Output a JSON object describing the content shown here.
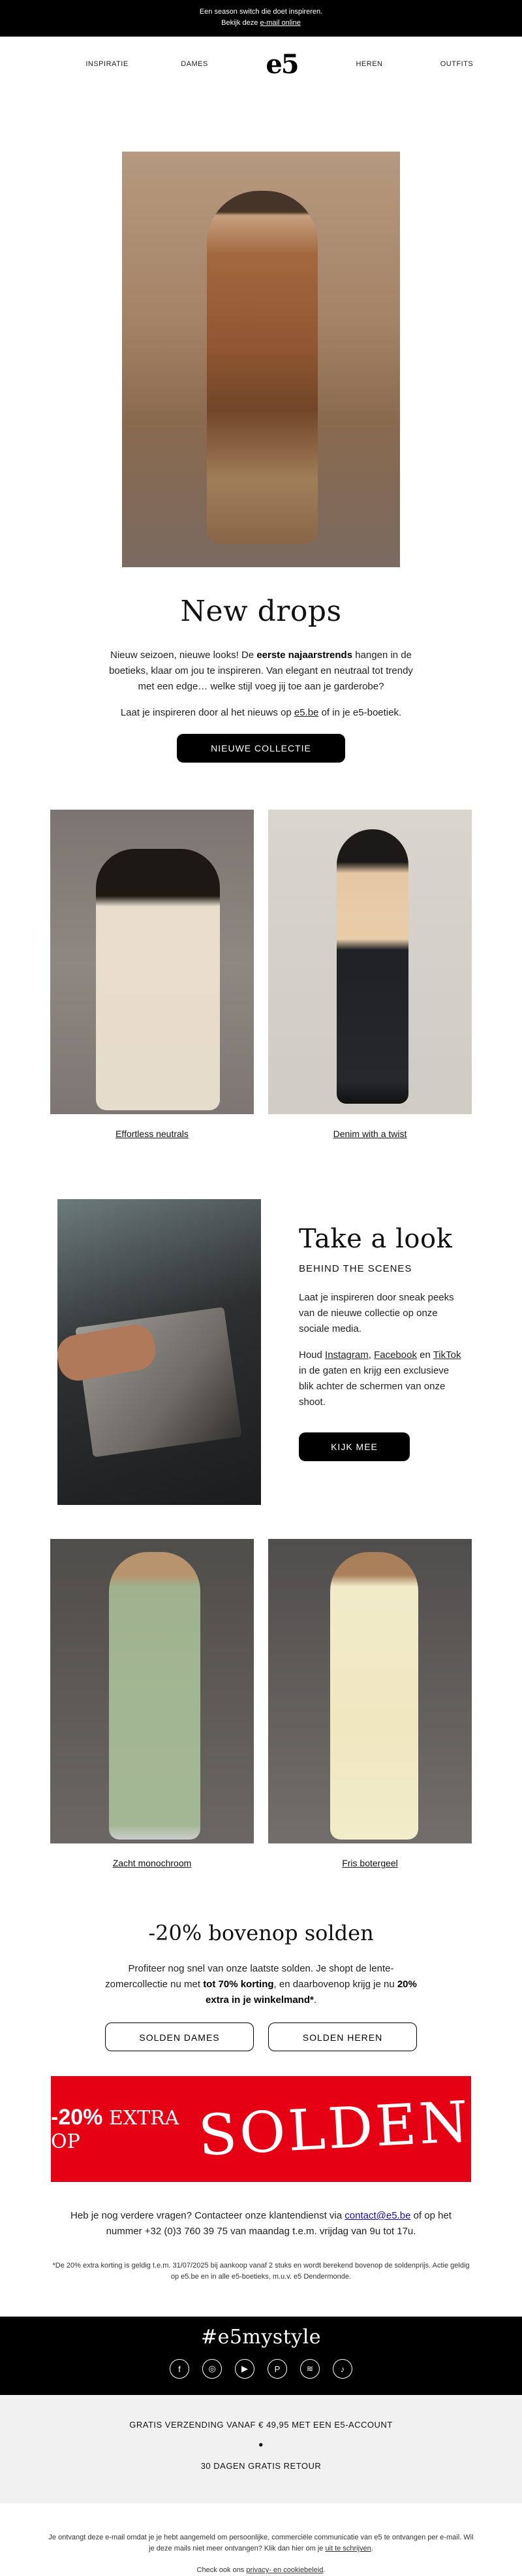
{
  "topbar": {
    "line1": "Een season switch die doet inspireren.",
    "line2_prefix": "Bekijk deze ",
    "line2_link": "e-mail online"
  },
  "nav": {
    "items": [
      "INSPIRATIE",
      "DAMES",
      "HEREN",
      "OUTFITS"
    ],
    "logo": "e5"
  },
  "hero": {
    "title": "New drops",
    "p1_a": "Nieuw seizoen, nieuwe looks! De ",
    "p1_b": "eerste najaarstrends",
    "p1_c": " hangen in de boetieks, klaar om jou te inspireren. Van elegant en neutraal tot trendy met een edge… welke stijl voeg jij toe aan je garderobe?",
    "p2_a": "Laat je inspireren door al het nieuws op ",
    "p2_link": "e5.be",
    "p2_b": " of in je e5-boetiek.",
    "button": "NIEUWE COLLECTIE"
  },
  "looks1": [
    {
      "caption": "Effortless neutrals"
    },
    {
      "caption": "Denim with a twist"
    }
  ],
  "take": {
    "title": "Take a look",
    "subtitle": "BEHIND THE SCENES",
    "p1": "Laat je inspireren door sneak peeks van de nieuwe collectie op onze sociale media.",
    "p2_a": "Houd ",
    "p2_instagram": "Instagram",
    "p2_comma": ", ",
    "p2_facebook": "Facebook",
    "p2_en": " en ",
    "p2_tiktok": "TikTok",
    "p2_b": " in de gaten en krijg een exclusieve blik achter de schermen van onze shoot.",
    "button": "KIJK MEE"
  },
  "looks2": [
    {
      "caption": "Zacht monochroom"
    },
    {
      "caption": "Fris botergeel"
    }
  ],
  "sale": {
    "title": "-20% bovenop solden",
    "p_a": "Profiteer nog snel van onze laatste solden. Je shopt de lente-zomercollectie nu met ",
    "p_b": "tot 70% korting",
    "p_c": ", en daarbovenop krijg je nu ",
    "p_d": "20% extra in je winkelmand*",
    "p_e": ".",
    "btn_dames": "SOLDEN DAMES",
    "btn_heren": "SOLDEN HEREN",
    "banner_pct": "-20%",
    "banner_text": " EXTRA OP",
    "banner_big": "SOLDEN"
  },
  "contact": {
    "a": "Heb je nog verdere vragen? Contacteer onze klantendienst via ",
    "link": "contact@e5.be",
    "b": " of op het nummer +32 (0)3 760 39 75 van maandag t.e.m. vrijdag van 9u tot 17u."
  },
  "fineprint": "*De 20% extra korting is geldig t.e.m. 31/07/2025 bij aankoop vanaf 2 stuks en wordt berekend bovenop de soldenprijs. Actie geldig op e5.be en in alle e5-boetieks, m.u.v. e5 Dendermonde.",
  "social": {
    "hashtag": "#e5mystyle",
    "icons": [
      "facebook-icon",
      "instagram-icon",
      "youtube-icon",
      "pinterest-icon",
      "spotify-icon",
      "tiktok-icon"
    ]
  },
  "perks": {
    "shipping": "GRATIS VERZENDING VANAF € 49,95 MET EEN E5-ACCOUNT",
    "dot": "•",
    "returns": "30 DAGEN GRATIS RETOUR"
  },
  "footer": {
    "l1": "Je ontvangt deze e-mail omdat je je hebt aangemeld om persoonlijke, commerciële communicatie van e5 te ontvangen per e-mail. Wil je deze mails niet meer ontvangen? Klik dan hier om je ",
    "unsub": "uit te schrijven",
    "l1_end": ".",
    "l2_a": "Check ook ons ",
    "privacy": "privacy- en cookiebeleid",
    "l2_b": "."
  },
  "colors": {
    "accent_red": "#e60013",
    "black": "#000000",
    "perks_bg": "#f1f1f1"
  }
}
